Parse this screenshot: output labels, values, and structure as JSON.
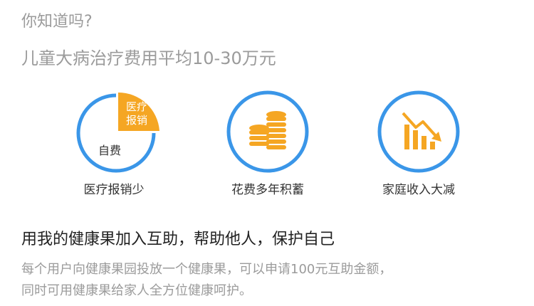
{
  "intro": {
    "question": "你知道吗?",
    "fact": "儿童大病治疗费用平均10-30万元"
  },
  "colors": {
    "accent_blue": "#3a96e8",
    "accent_orange": "#f5a623",
    "text_gray": "#9b9b9b",
    "text_dark": "#333333"
  },
  "features": [
    {
      "icon": "pie-chart-icon",
      "label": "医疗报销少",
      "pie_labels": {
        "self_pay": "自费",
        "reimburse_line1": "医疗",
        "reimburse_line2": "报销"
      }
    },
    {
      "icon": "coin-stack-icon",
      "label": "花费多年积蓄"
    },
    {
      "icon": "declining-chart-icon",
      "label": "家庭收入大减"
    }
  ],
  "promo": {
    "headline": "用我的健康果加入互助，帮助他人，保护自己",
    "description_line1": "每个用户向健康果园投放一个健康果，可以申请100元互助金额，",
    "description_line2": "同时可用健康果给家人全方位健康呵护。"
  }
}
